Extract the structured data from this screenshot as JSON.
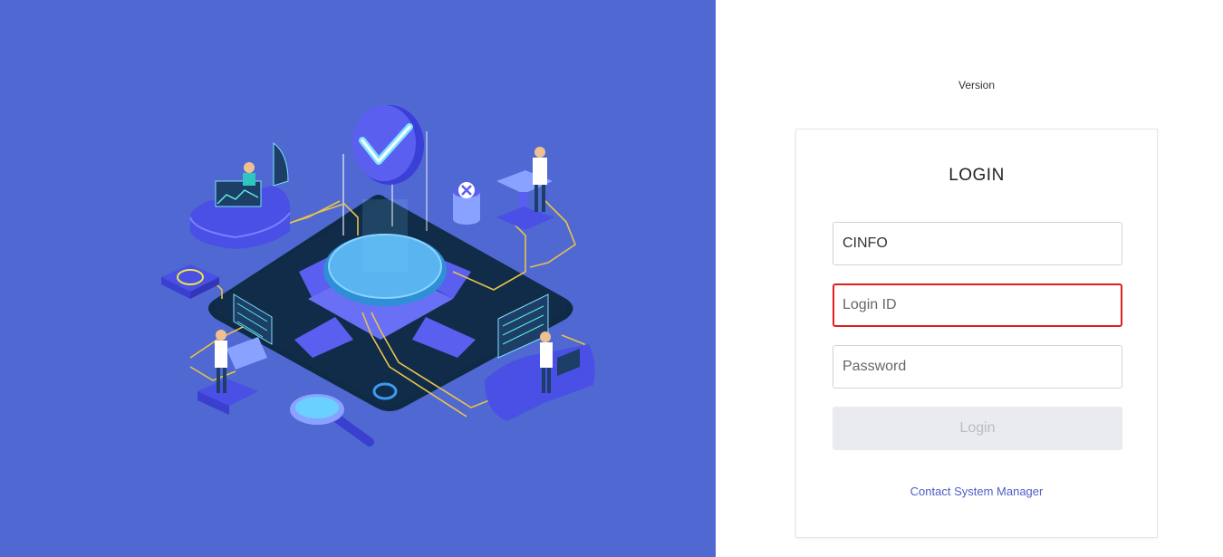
{
  "header": {
    "version_label": "Version"
  },
  "login": {
    "title": "LOGIN",
    "company_value": "CINFO",
    "login_id_placeholder": "Login ID",
    "password_placeholder": "Password",
    "login_button_label": "Login",
    "contact_link_label": "Contact System Manager"
  },
  "illustration": {
    "icons": [
      "checkmark-shield-icon",
      "close-badge-icon",
      "magnifier-icon",
      "server-platform-icon"
    ]
  },
  "colors": {
    "left_background": "#5068d1",
    "error_border": "#e01e1e",
    "link": "#4a5fc8",
    "disabled_button": "#e9ebee"
  }
}
